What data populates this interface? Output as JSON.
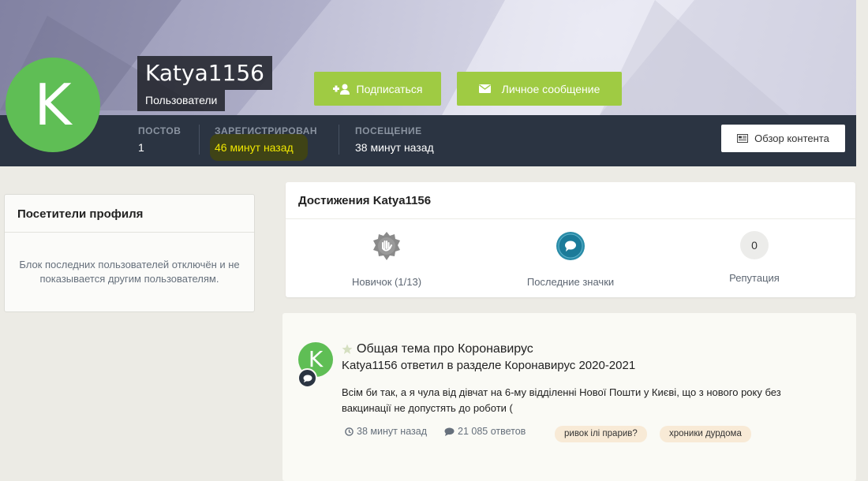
{
  "profile": {
    "username": "Katya1156",
    "avatar_letter": "K",
    "group": "Пользователи",
    "follow_label": "Подписаться",
    "message_label": "Личное сообщение",
    "content_label": "Обзор контента",
    "stats": [
      {
        "label": "ПОСТОВ",
        "value": "1"
      },
      {
        "label": "ЗАРЕГИСТРИРОВАН",
        "value": "46 минут назад"
      },
      {
        "label": "ПОСЕЩЕНИЕ",
        "value": "38 минут назад"
      }
    ]
  },
  "visitors": {
    "title": "Посетители профиля",
    "message": "Блок последних пользователей отключён и не показывается другим пользователям."
  },
  "achievements": {
    "title": "Достижения Katya1156",
    "items": [
      {
        "label": "Новичок (1/13)",
        "icon": "rank-badge-icon"
      },
      {
        "label": "Последние значки",
        "icon": "speech-bubble-icon"
      },
      {
        "label": "Репутация",
        "value": "0"
      }
    ]
  },
  "activity": {
    "avatar_letter": "K",
    "topic_title": "Общая тема про Коронавирус",
    "action": "Katya1156 ответил в разделе Коронавирус 2020-2021",
    "text": "Всім би так, а я чула від дівчат на 6-му відділенні Нової Пошти у Києві, що з нового року без вакцинації не допустять до роботи (",
    "time": "38 минут назад",
    "replies": "21 085 ответов",
    "tags": [
      "ривок ілі прарив?",
      "хроники дурдома"
    ]
  },
  "colors": {
    "accent_green": "#9fcb43",
    "avatar_green": "#5fbe55",
    "dark_bar": "#2b3442",
    "highlight_text": "#f0e700"
  }
}
